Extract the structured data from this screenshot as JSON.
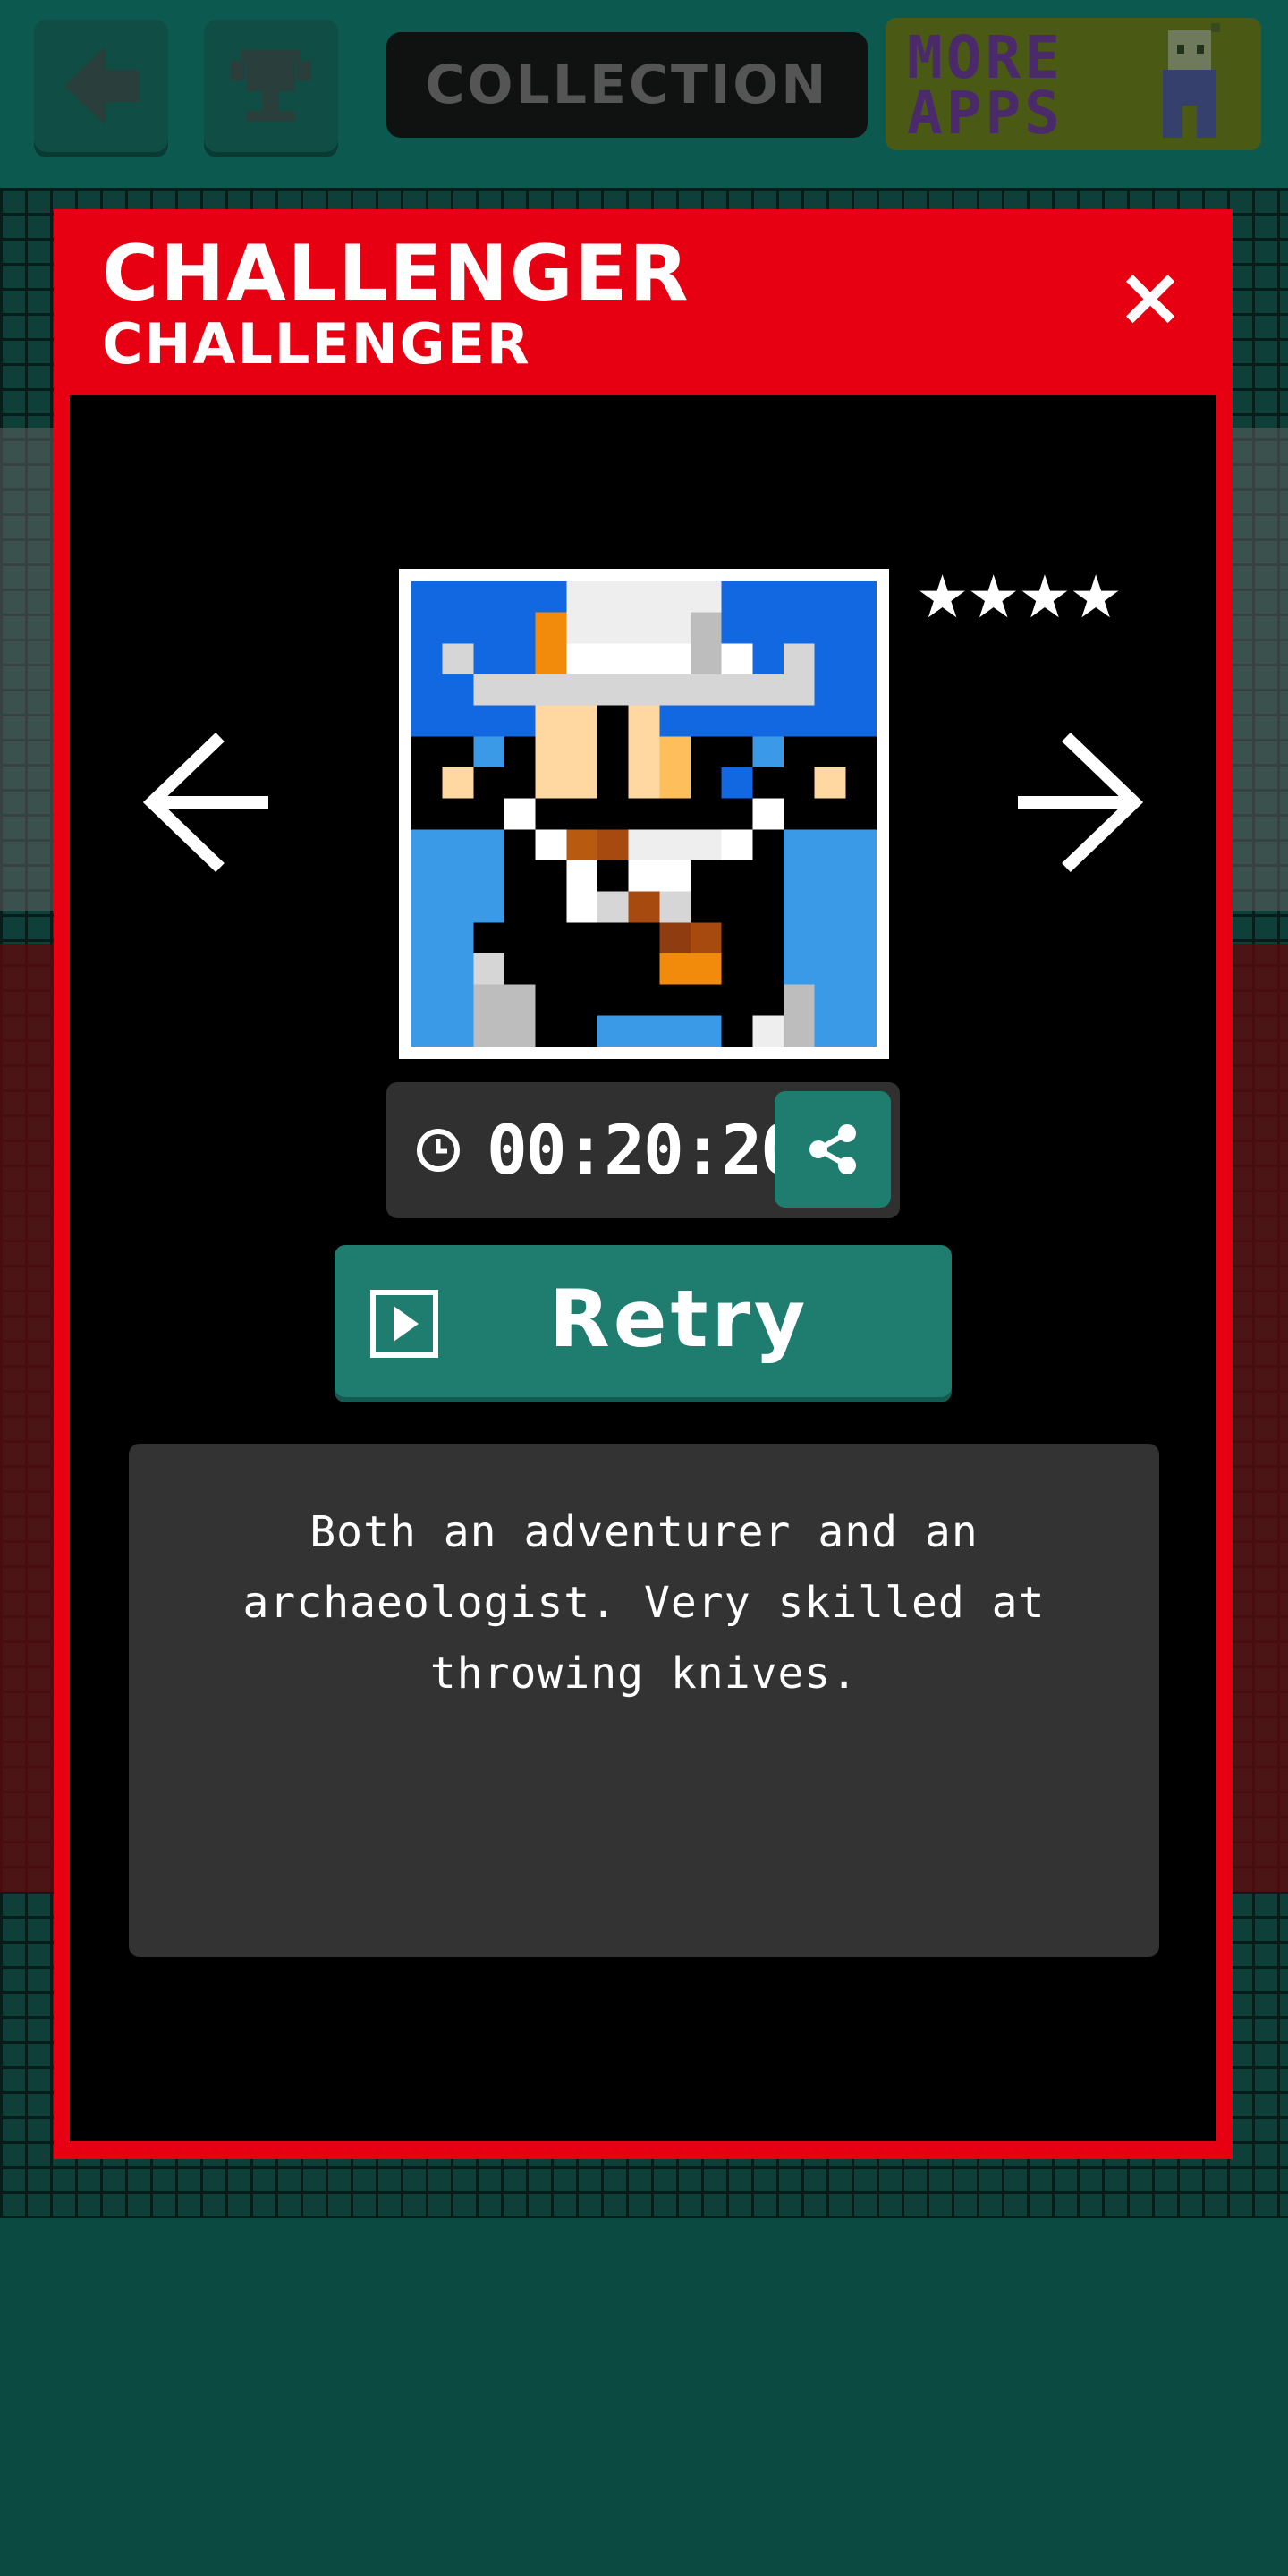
{
  "header": {
    "back_icon": "back-arrow-icon",
    "trophy_icon": "trophy-icon",
    "title": "COLLECTION",
    "more_apps_label": "MORE APPS"
  },
  "modal": {
    "title": "CHALLENGER",
    "subtitle": "CHALLENGER",
    "close_label": "×",
    "rating": "★★★★",
    "rating_value": 4,
    "rating_max": 4,
    "time": "00:20:20",
    "retry_label": "Retry",
    "description": "Both an adventurer and an archaeologist. Very skilled at throwing knives."
  },
  "colors": {
    "accent_red": "#e60012",
    "teal": "#1e7d6f",
    "panel": "#333333"
  }
}
